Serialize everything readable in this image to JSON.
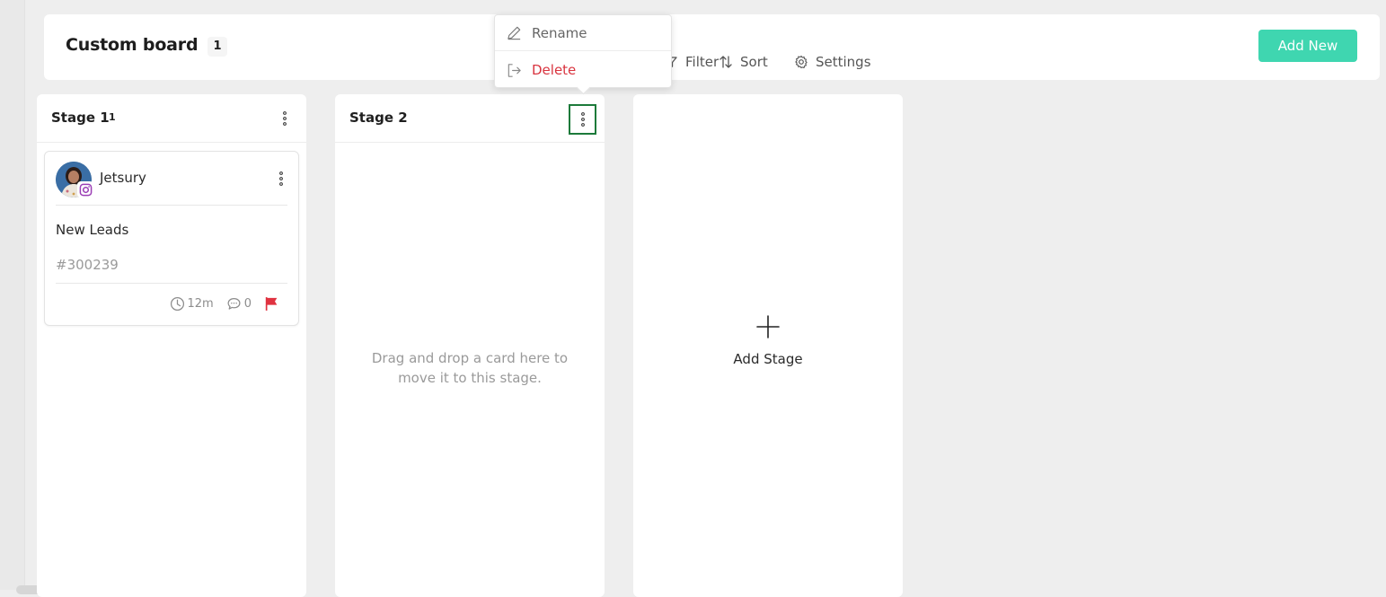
{
  "header": {
    "title": "Custom board",
    "count": "1",
    "filter_label": "Filter",
    "sort_label": "Sort",
    "settings_label": "Settings",
    "add_new_label": "Add New"
  },
  "context_menu": {
    "rename_label": "Rename",
    "delete_label": "Delete"
  },
  "stages": [
    {
      "title": "Stage 1",
      "count": "1"
    },
    {
      "title": "Stage 2",
      "count": ""
    }
  ],
  "card": {
    "name": "Jetsury",
    "stage_label": "New Leads",
    "id": "#300239",
    "time": "12m",
    "comments": "0",
    "channel_icon": "instagram-icon",
    "flag_color": "#e03240"
  },
  "empty_stage": {
    "message": "Drag and drop a card here to move it to this stage."
  },
  "add_stage": {
    "label": "Add Stage"
  },
  "colors": {
    "accent": "#3fd6b0",
    "danger": "#d9343f",
    "active_outline": "#1c7a3a",
    "background": "#eeeeee"
  }
}
